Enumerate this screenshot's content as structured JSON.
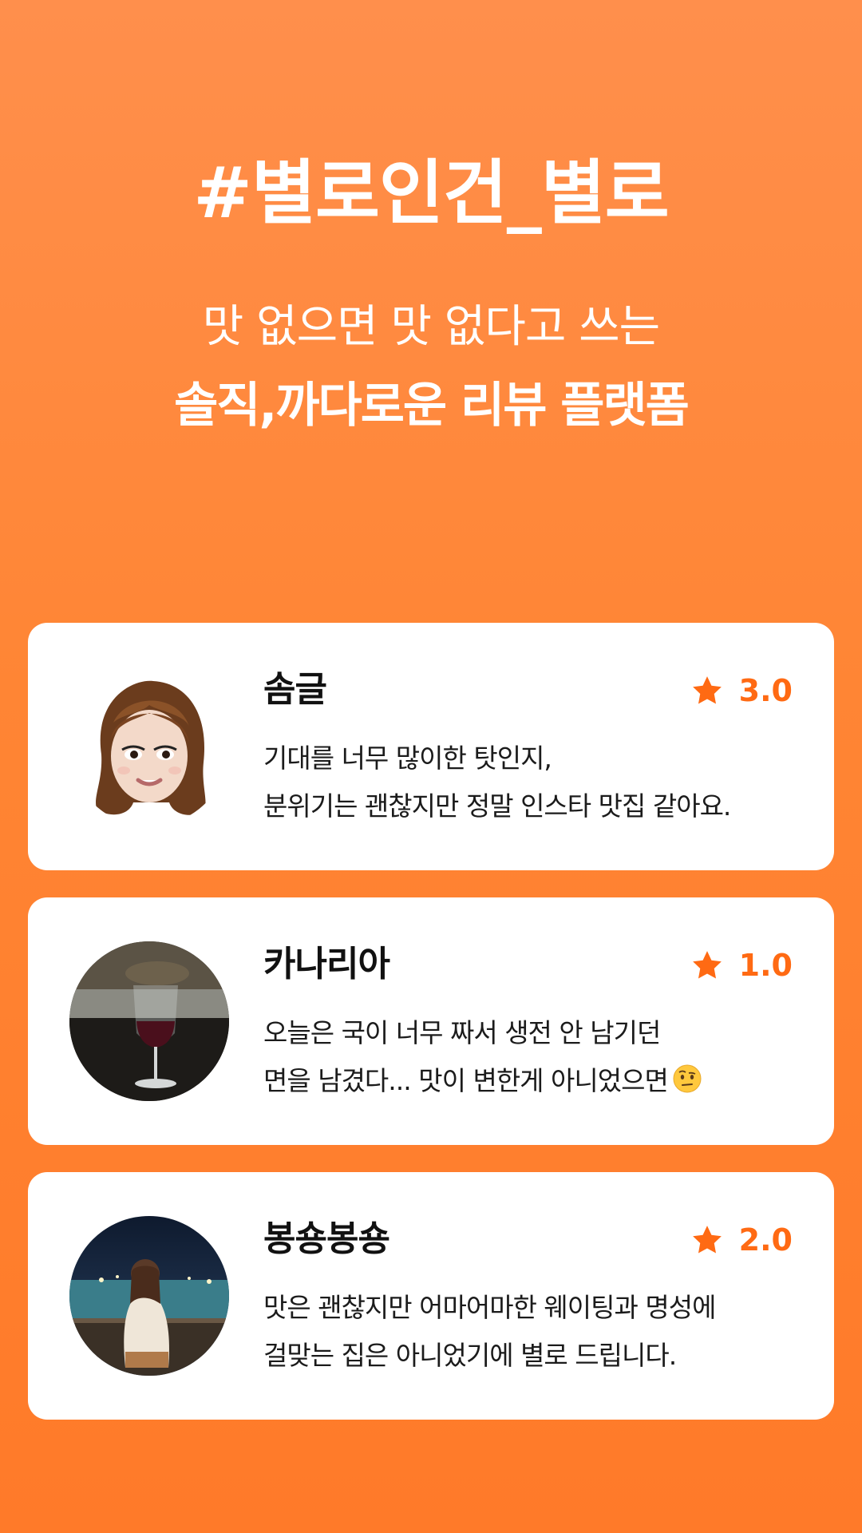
{
  "hero": {
    "title": "#별로인건_별로",
    "subtitle": "맛 없으면 맛 없다고 쓰는",
    "tagline": "솔직,까다로운 리뷰 플랫폼"
  },
  "colors": {
    "background": "#FF8534",
    "accent": "#FF6A13",
    "card": "#FFFFFF"
  },
  "reviews": [
    {
      "name": "솜글",
      "rating": "3.0",
      "lines": [
        "기대를 너무 많이한 탓인지,",
        "분위기는 괜찮지만 정말 인스타 맛집 같아요."
      ],
      "avatar": "memoji-avatar"
    },
    {
      "name": "카나리아",
      "rating": "1.0",
      "lines": [
        "오늘은 국이 너무 짜서 생전 안 남기던",
        "면을 남겼다... 맛이 변한게 아니었으면"
      ],
      "emoji": "raised-eyebrow-emoji",
      "avatar": "wine-glass-photo"
    },
    {
      "name": "봉숑봉숑",
      "rating": "2.0",
      "lines": [
        "맛은 괜찮지만 어마어마한 웨이팅과 명성에",
        "걸맞는 집은 아니었기에 별로 드립니다."
      ],
      "avatar": "night-view-photo"
    }
  ]
}
